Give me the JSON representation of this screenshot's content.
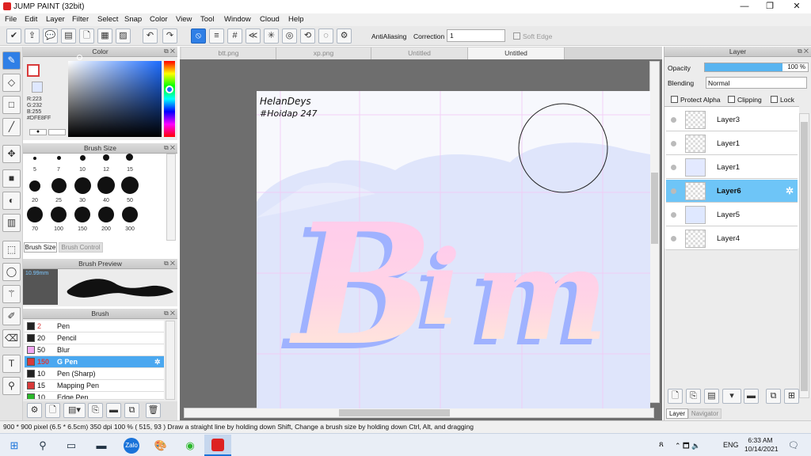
{
  "window": {
    "title": "JUMP PAINT (32bit)",
    "min": "—",
    "max": "❐",
    "close": "✕"
  },
  "menu": [
    "File",
    "Edit",
    "Layer",
    "Filter",
    "Select",
    "Snap",
    "Color",
    "View",
    "Tool",
    "Window",
    "Cloud",
    "Help"
  ],
  "toolbar": {
    "antialias_label": "AntiAliasing",
    "correction_label": "Correction",
    "correction_value": "1",
    "softedge_label": "Soft Edge"
  },
  "tabs": [
    "btt.png",
    "xp.png",
    "Untitled",
    "Untitled"
  ],
  "color_panel": {
    "title": "Color",
    "r": "R:223",
    "g": "G:232",
    "b": "B:255",
    "hex": "#DFE8FF",
    "accent": "#DFE8FF"
  },
  "brush_size": {
    "title": "Brush Size",
    "labels": [
      "5",
      "7",
      "10",
      "12",
      "15",
      "20",
      "25",
      "30",
      "40",
      "50",
      "70",
      "100",
      "150",
      "200",
      "300"
    ],
    "tab1": "Brush Size",
    "tab2": "Brush Control"
  },
  "brush_preview": {
    "title": "Brush Preview",
    "size": "10.99mm"
  },
  "brush": {
    "title": "Brush",
    "items": [
      {
        "size": "2",
        "name": "Pen",
        "color": "#222222"
      },
      {
        "size": "20",
        "name": "Pencil",
        "color": "#222222"
      },
      {
        "size": "50",
        "name": "Blur",
        "color": "#f2a6f2"
      },
      {
        "size": "150",
        "name": "G Pen",
        "color": "#d83a3a"
      },
      {
        "size": "10",
        "name": "Pen (Sharp)",
        "color": "#222222"
      },
      {
        "size": "15",
        "name": "Mapping Pen",
        "color": "#d83a3a"
      },
      {
        "size": "10",
        "name": "Edge Pen",
        "color": "#2bb82b"
      }
    ]
  },
  "art": {
    "signature": "HelanDeys",
    "hashtag": "#Hoidap 247",
    "word": "Bim"
  },
  "layer_panel": {
    "title": "Layer",
    "opacity_label": "Opacity",
    "opacity_value": "100 %",
    "opacity_fraction": 1.0,
    "blending_label": "Blending",
    "blending_value": "Normal",
    "protect_alpha": "Protect Alpha",
    "clipping": "Clipping",
    "lock": "Lock",
    "layers": [
      "Layer3",
      "Layer1",
      "Layer1",
      "Layer6",
      "Layer5",
      "Layer4"
    ],
    "tab_layer": "Layer",
    "tab_navigator": "Navigator"
  },
  "status": {
    "text": "900 * 900 pixel   (6.5 * 6.5cm)   350 dpi   100 %   ( 515, 93 )   Draw a straight line by holding down Shift, Change a brush size by holding down Ctrl, Alt, and dragging"
  },
  "taskbar": {
    "lang": "ENG",
    "time": "6:33 AM",
    "date": "10/14/2021"
  }
}
